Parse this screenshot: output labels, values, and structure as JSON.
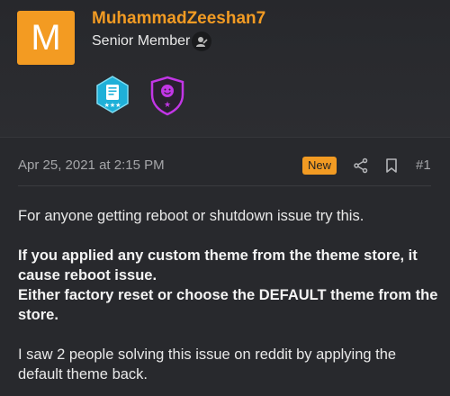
{
  "user": {
    "avatar_letter": "M",
    "avatar_color": "#f39b22",
    "name": "MuhammadZeeshan7",
    "name_color": "#f29b23",
    "role": "Senior Member",
    "role_icon": "user-badge-icon",
    "badges": [
      {
        "icon": "document-badge-icon",
        "color": "#1fb0d8"
      },
      {
        "icon": "shield-smile-badge-icon",
        "color": "#c236e6"
      }
    ]
  },
  "post": {
    "date": "Apr 25, 2021 at 2:15 PM",
    "new_label": "New",
    "share_icon": "share-icon",
    "bookmark_icon": "bookmark-icon",
    "number": "#1",
    "line1": "For anyone getting reboot or shutdown issue try this.",
    "bold1": "If you applied any custom theme from the theme store, it cause reboot issue.",
    "bold2": "Either factory reset or choose the DEFAULT theme from the store.",
    "line2": "I saw 2 people solving this issue on reddit by applying the default theme back."
  }
}
